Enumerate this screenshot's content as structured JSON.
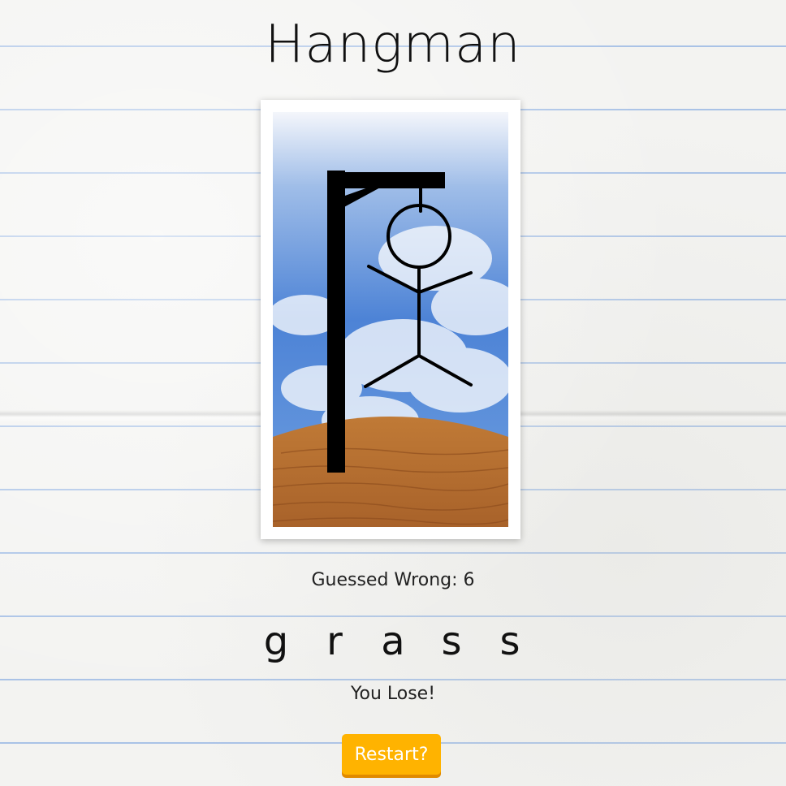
{
  "title": "Hangman",
  "stats": {
    "wrong_label": "Guessed Wrong: 6",
    "wrong_count": 6
  },
  "word": {
    "letters": [
      "g",
      "r",
      "a",
      "s",
      "s"
    ]
  },
  "result": {
    "message": "You Lose!"
  },
  "controls": {
    "restart_label": "Restart?"
  },
  "colors": {
    "button": "#ffb300",
    "button_shadow": "#e08a00",
    "ruled_line": "#a9c2e6"
  },
  "scene": {
    "parts_shown": [
      "gallows",
      "rope",
      "head",
      "arms",
      "body",
      "legs"
    ]
  }
}
